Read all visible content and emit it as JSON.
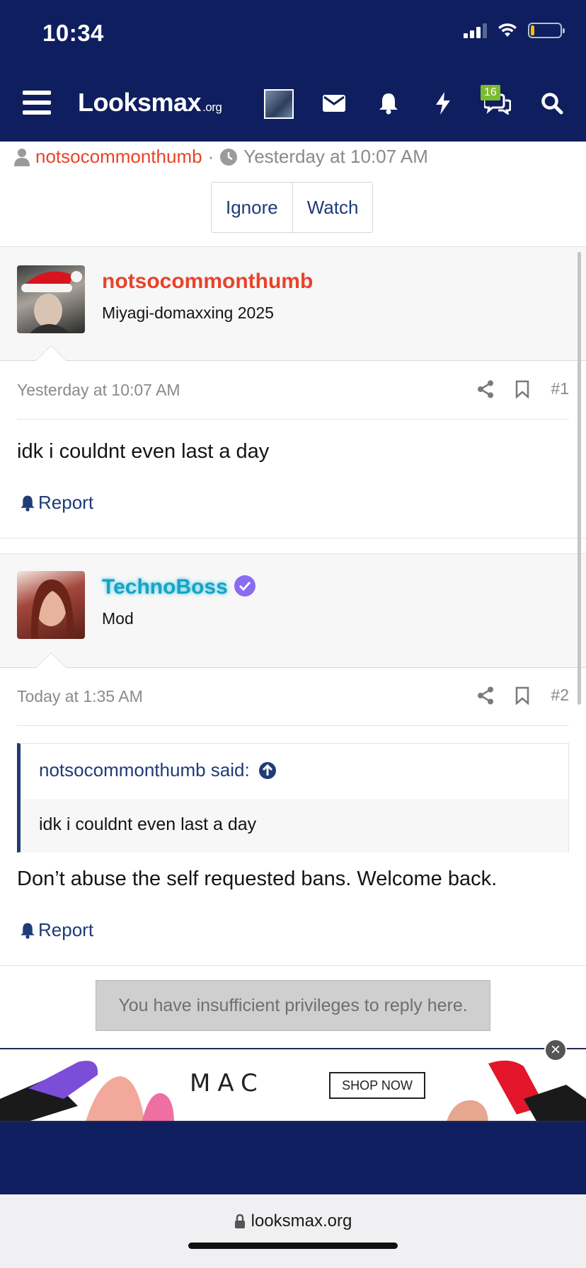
{
  "status_bar": {
    "time": "10:34"
  },
  "header": {
    "logo": "Looksmax",
    "logo_suffix": ".org",
    "conversations_badge": "16",
    "icons": [
      "menu-icon",
      "avatar",
      "mail-icon",
      "bell-icon",
      "bolt-icon",
      "chat-icon",
      "search-icon"
    ]
  },
  "thread": {
    "author": "notsocommonthumb",
    "separator": "·",
    "time": "Yesterday at 10:07 AM",
    "ignore_label": "Ignore",
    "watch_label": "Watch"
  },
  "posts": [
    {
      "username": "notsocommonthumb",
      "username_color": "#e8432b",
      "user_title": "Miyagi-domaxxing 2025",
      "date": "Yesterday at 10:07 AM",
      "number": "#1",
      "body": "idk i couldnt even last a day",
      "report_label": "Report"
    },
    {
      "username": "TechnoBoss",
      "username_color": "#16a3c4",
      "user_title": "Mod",
      "date": "Today at 1:35 AM",
      "number": "#2",
      "quote_author": "notsocommonthumb said:",
      "quote_text": "idk i couldnt even last a day",
      "body": "Don’t abuse the self requested bans. Welcome back.",
      "report_label": "Report"
    }
  ],
  "reply_notice": "You have insufficient privileges to reply here.",
  "ad": {
    "brand": "MAC",
    "cta": "SHOP NOW"
  },
  "browser": {
    "url": "looksmax.org"
  },
  "colors": {
    "navy": "#0f1e5e",
    "link": "#1f3b78",
    "author_red": "#e8432b",
    "verified": "#8b6cf0"
  }
}
